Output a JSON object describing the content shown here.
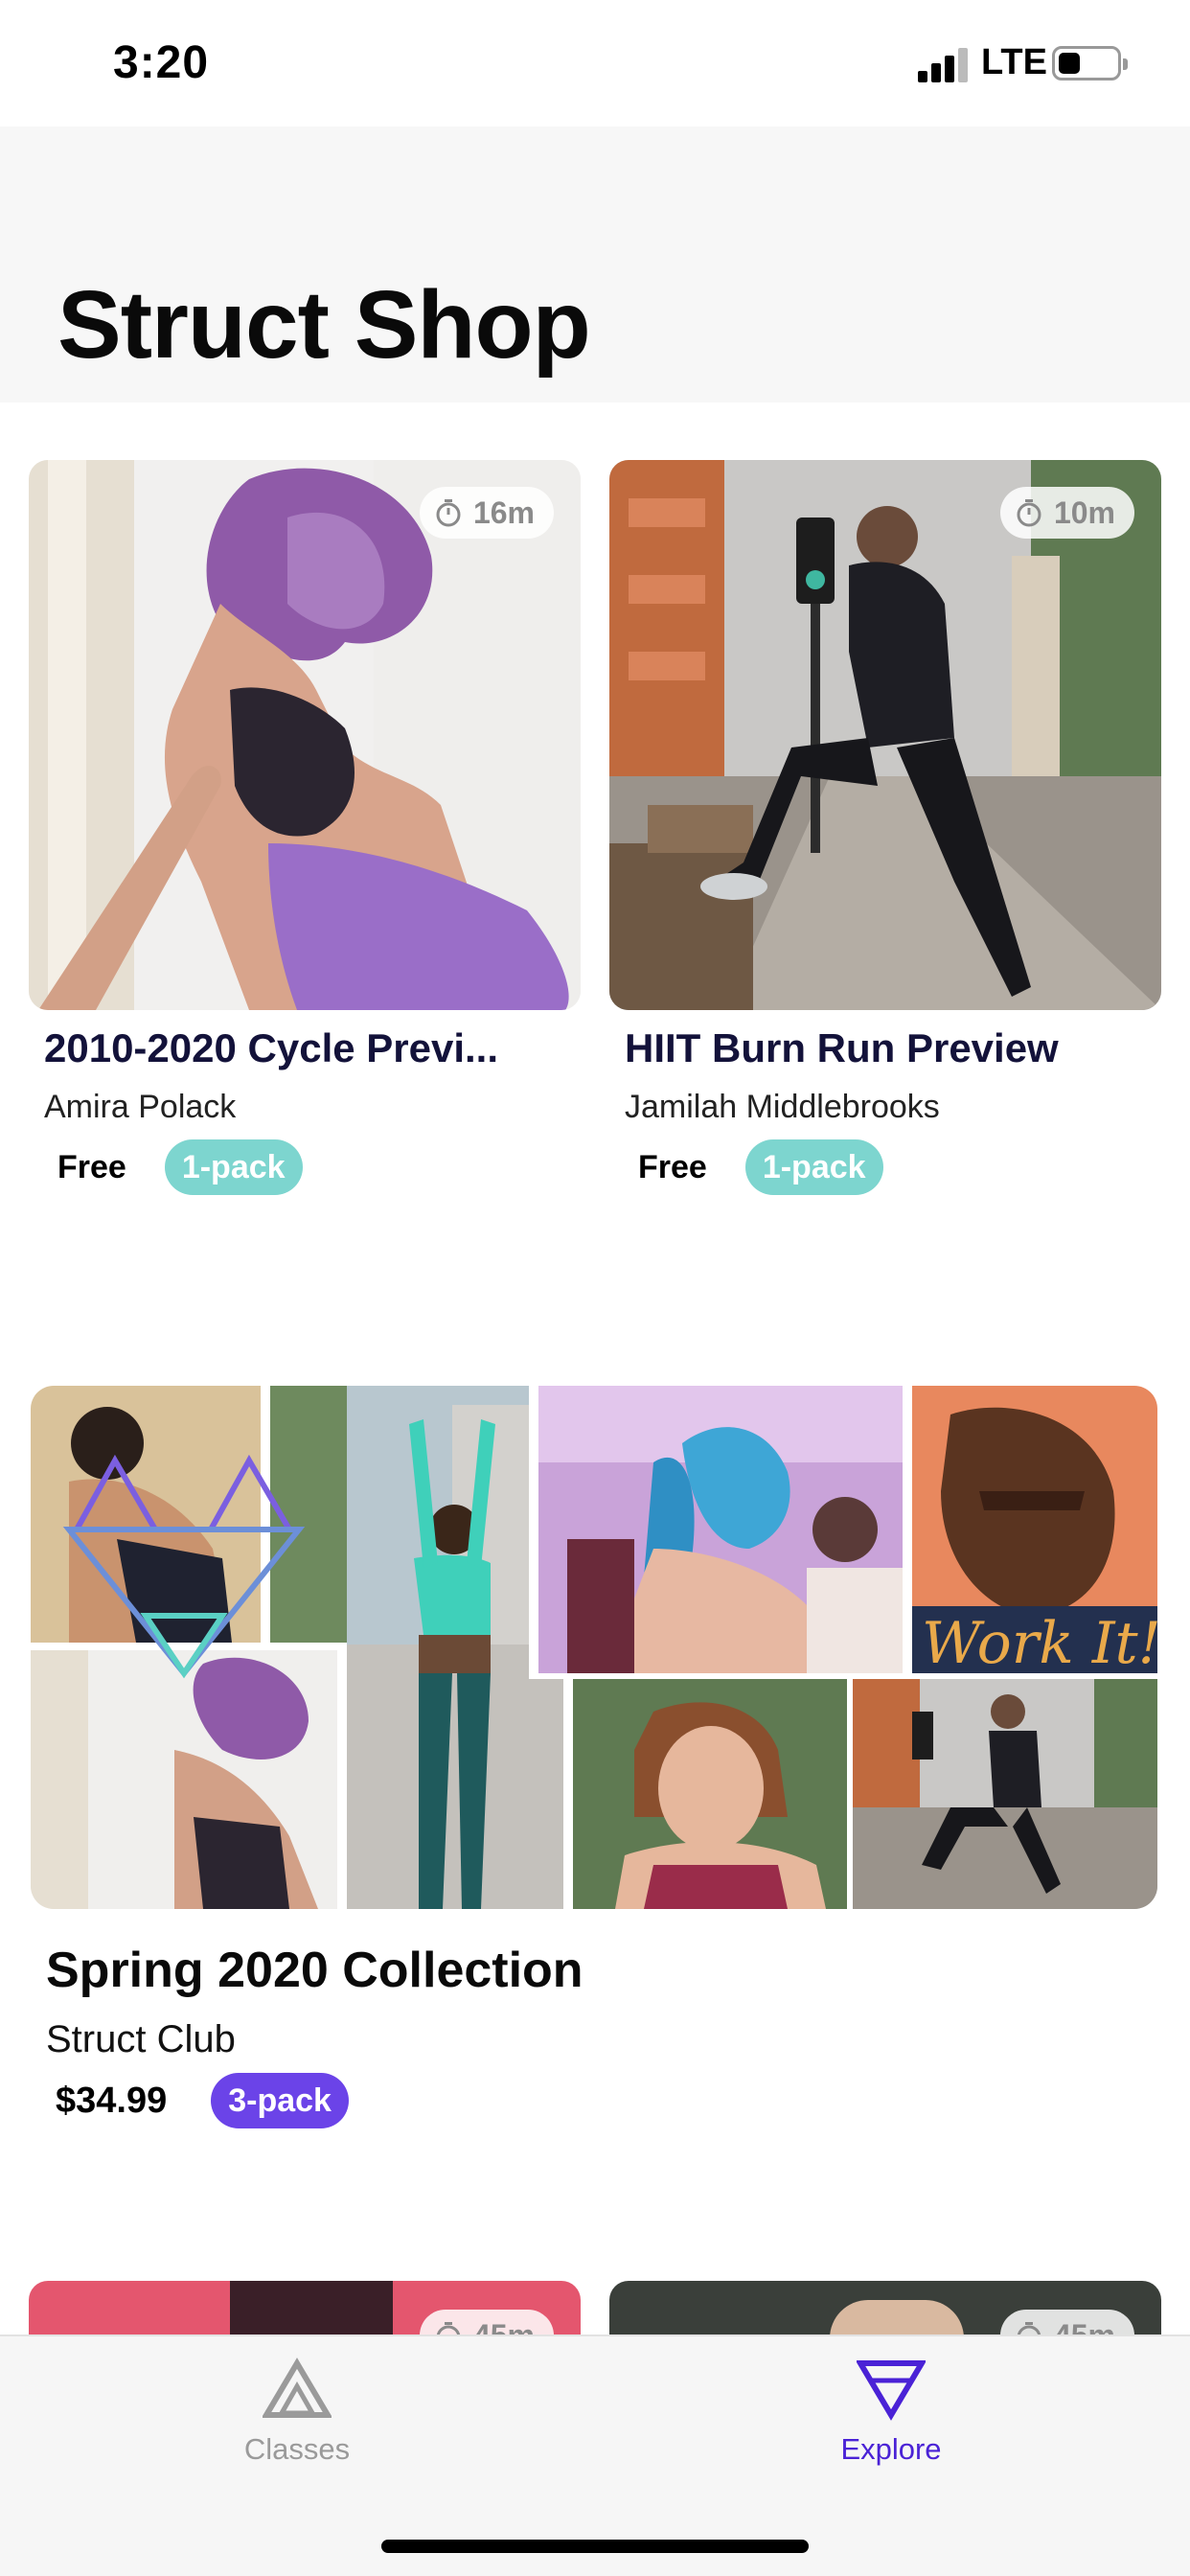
{
  "status_bar": {
    "time": "3:20",
    "network": "LTE"
  },
  "header": {
    "title": "Struct Shop"
  },
  "cards": [
    {
      "duration": "16m",
      "title": "2010-2020 Cycle Previ...",
      "instructor": "Amira Polack",
      "price": "Free",
      "pack": "1-pack"
    },
    {
      "duration": "10m",
      "title": "HIIT Burn Run Preview",
      "instructor": "Jamilah Middlebrooks",
      "price": "Free",
      "pack": "1-pack"
    }
  ],
  "collection": {
    "title": "Spring 2020 Collection",
    "creator": "Struct Club",
    "price": "$34.99",
    "pack": "3-pack",
    "collage_text": "Work It!"
  },
  "partial_cards": [
    {
      "duration": "45m"
    },
    {
      "duration": "45m"
    }
  ],
  "tab_bar": {
    "tabs": [
      {
        "label": "Classes",
        "icon": "classes-triangle-icon",
        "active": false
      },
      {
        "label": "Explore",
        "icon": "explore-triangle-icon",
        "active": true
      }
    ]
  },
  "colors": {
    "pack_single": "#7dd5cf",
    "pack_multi": "#6b43e8",
    "active_tab": "#4a22d6",
    "inactive_tab": "#9a9a9a",
    "title_dark": "#13123a"
  }
}
